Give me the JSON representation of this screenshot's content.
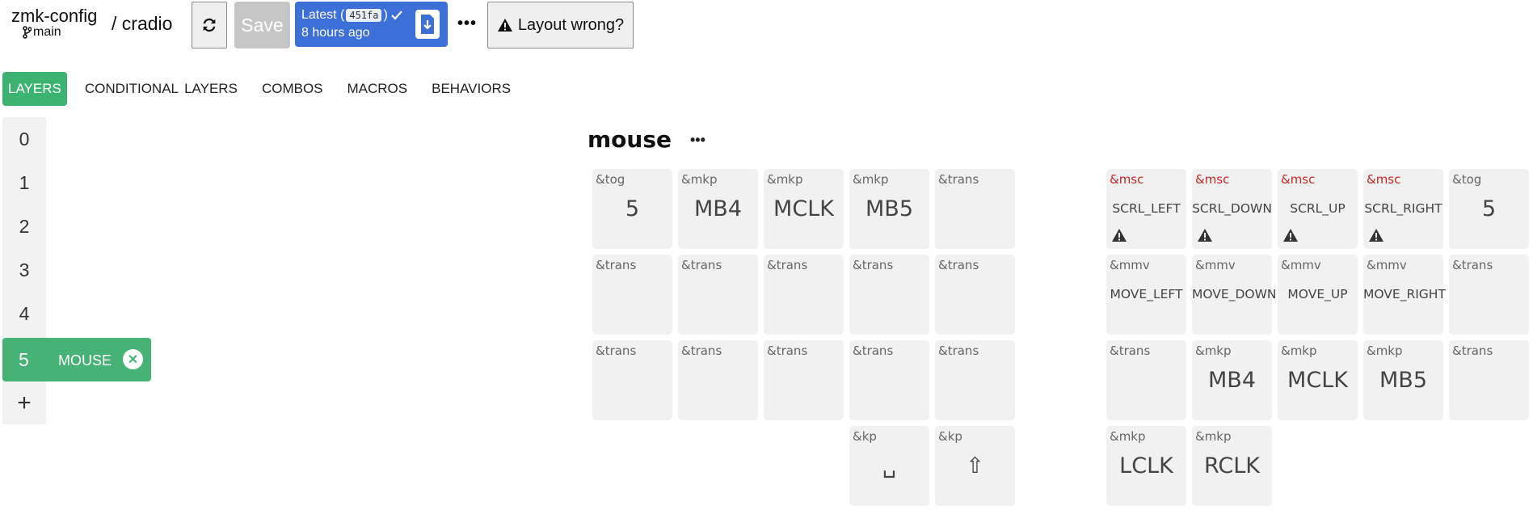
{
  "header": {
    "repo": "zmk-config",
    "branch": "main",
    "keyboard": "/ cradio",
    "save_label": "Save",
    "latest_label": "Latest (",
    "latest_commit": "451fa",
    "latest_paren": ")",
    "latest_time": "8 hours ago",
    "more_label": "•••",
    "layout_wrong_label": "Layout wrong?"
  },
  "tabs": [
    "LAYERS",
    "CONDITIONAL LAYERS",
    "COMBOS",
    "MACROS",
    "BEHAVIORS"
  ],
  "layers": {
    "items": [
      "0",
      "1",
      "2",
      "3",
      "4"
    ],
    "selected_number": "5",
    "selected_name": "MOUSE",
    "close_label": "✕",
    "add_label": "+"
  },
  "layer_title": "mouse",
  "layer_menu": "•••",
  "keys": [
    {
      "b": "&tog",
      "p": "5"
    },
    {
      "b": "&mkp",
      "p": "MB4"
    },
    {
      "b": "&mkp",
      "p": "MCLK"
    },
    {
      "b": "&mkp",
      "p": "MB5"
    },
    {
      "b": "&trans",
      "p": ""
    },
    {
      "b": "&msc",
      "p": "SCRL_LEFT"
    },
    {
      "b": "&msc",
      "p": "SCRL_DOWN"
    },
    {
      "b": "&msc",
      "p": "SCRL_UP"
    },
    {
      "b": "&msc",
      "p": "SCRL_RIGHT"
    },
    {
      "b": "&tog",
      "p": "5"
    },
    {
      "b": "&trans",
      "p": ""
    },
    {
      "b": "&trans",
      "p": ""
    },
    {
      "b": "&trans",
      "p": ""
    },
    {
      "b": "&trans",
      "p": ""
    },
    {
      "b": "&trans",
      "p": ""
    },
    {
      "b": "&mmv",
      "p": "MOVE_LEFT"
    },
    {
      "b": "&mmv",
      "p": "MOVE_DOWN"
    },
    {
      "b": "&mmv",
      "p": "MOVE_UP"
    },
    {
      "b": "&mmv",
      "p": "MOVE_RIGHT"
    },
    {
      "b": "&trans",
      "p": ""
    },
    {
      "b": "&trans",
      "p": ""
    },
    {
      "b": "&trans",
      "p": ""
    },
    {
      "b": "&trans",
      "p": ""
    },
    {
      "b": "&trans",
      "p": ""
    },
    {
      "b": "&trans",
      "p": ""
    },
    {
      "b": "&trans",
      "p": ""
    },
    {
      "b": "&mkp",
      "p": "MB4"
    },
    {
      "b": "&mkp",
      "p": "MCLK"
    },
    {
      "b": "&mkp",
      "p": "MB5"
    },
    {
      "b": "&trans",
      "p": ""
    },
    {
      "b": "&kp",
      "p": "␣"
    },
    {
      "b": "&kp",
      "p": "⇧"
    },
    {
      "b": "&mkp",
      "p": "LCLK"
    },
    {
      "b": "&mkp",
      "p": "RCLK"
    }
  ],
  "colors": {
    "accent_green": "#46b276",
    "latest_blue": "#3d6fd9",
    "warning_red": "#c62828",
    "key_bg": "#f1f1f1"
  }
}
